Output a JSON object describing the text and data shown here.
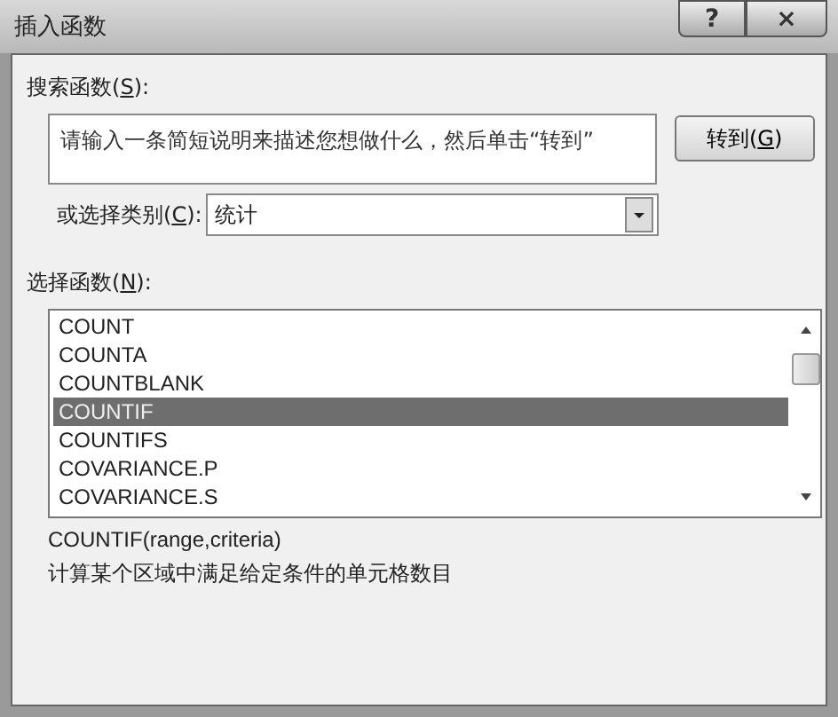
{
  "window": {
    "title": "插入函数",
    "help_button": "?",
    "close_button": "×"
  },
  "search": {
    "label_parts": [
      "搜索函数(",
      "S",
      "):"
    ],
    "placeholder": "请输入一条简短说明来描述您想做什么，然后单击“转到”",
    "button_parts": [
      "转到(",
      "G",
      ")"
    ]
  },
  "category": {
    "label_parts": [
      "或选择类别(",
      "C",
      "):"
    ],
    "value": "统计"
  },
  "functions": {
    "label_parts": [
      "选择函数(",
      "N",
      "):"
    ],
    "items": [
      {
        "name": "COUNT",
        "selected": false
      },
      {
        "name": "COUNTA",
        "selected": false
      },
      {
        "name": "COUNTBLANK",
        "selected": false
      },
      {
        "name": "COUNTIF",
        "selected": true
      },
      {
        "name": "COUNTIFS",
        "selected": false
      },
      {
        "name": "COVARIANCE.P",
        "selected": false
      },
      {
        "name": "COVARIANCE.S",
        "selected": false
      }
    ]
  },
  "syntax": "COUNTIF(range,criteria)",
  "description": "计算某个区域中满足给定条件的单元格数目"
}
